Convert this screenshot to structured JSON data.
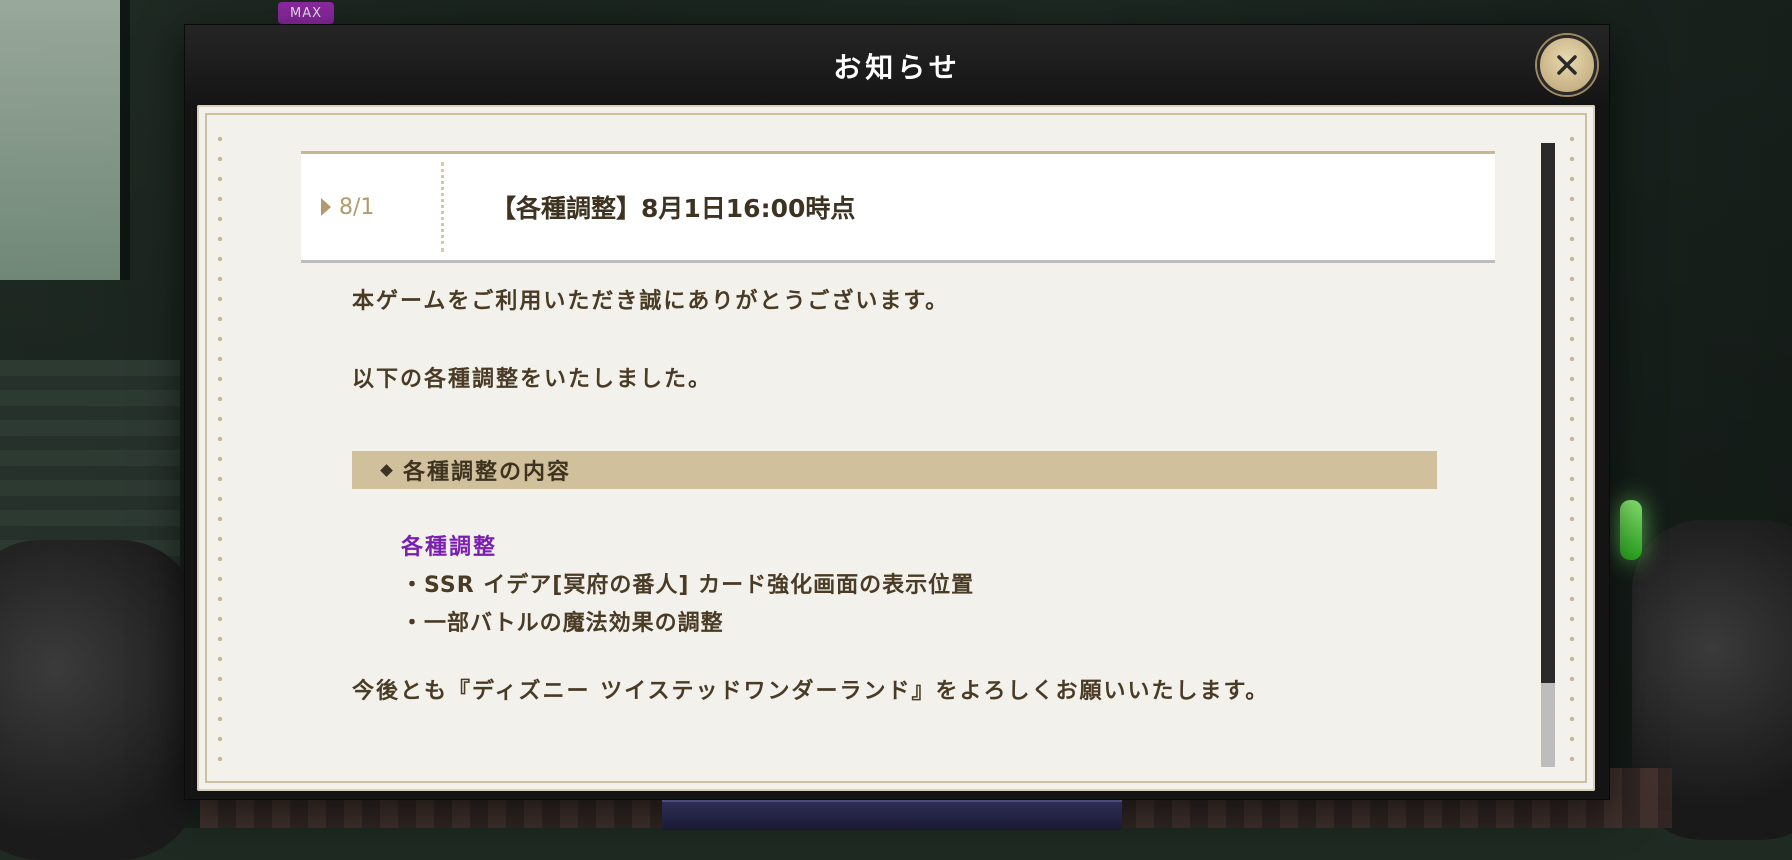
{
  "badge": {
    "max_label": "MAX"
  },
  "dialog": {
    "title": "お知らせ",
    "close_icon": "close-icon"
  },
  "notice": {
    "date": "8/1",
    "title": "【各種調整】8月1日16:00時点",
    "intro": "本ゲームをご利用いただき誠にありがとうございます。",
    "summary": "以下の各種調整をいたしました。",
    "section_title": "各種調整の内容",
    "sub_heading": "各種調整",
    "items": [
      "・SSR イデア[冥府の番人] カード強化画面の表示位置",
      "・一部バトルの魔法効果の調整"
    ],
    "closing": "今後とも『ディズニー ツイステッドワンダーランド』をよろしくお願いいたします。"
  },
  "colors": {
    "accent_purple": "#7a1fb0",
    "gold": "#b29a6b",
    "section_bg": "#d1c09c"
  }
}
